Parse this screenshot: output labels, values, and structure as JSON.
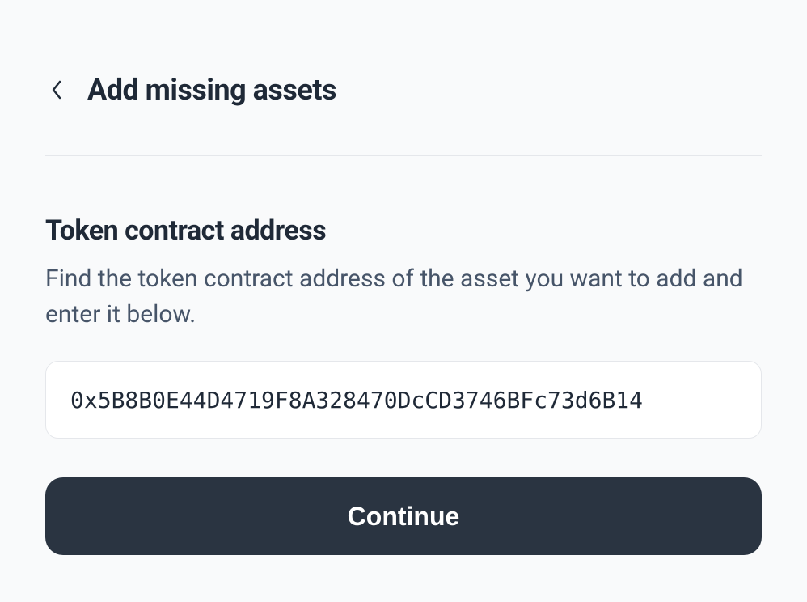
{
  "header": {
    "title": "Add missing assets"
  },
  "form": {
    "section_title": "Token contract address",
    "section_description": "Find the token contract address of the asset you want to add and enter it below.",
    "input_value": "0x5B8B0E44D4719F8A328470DcCD3746BFc73d6B14",
    "submit_label": "Continue"
  }
}
